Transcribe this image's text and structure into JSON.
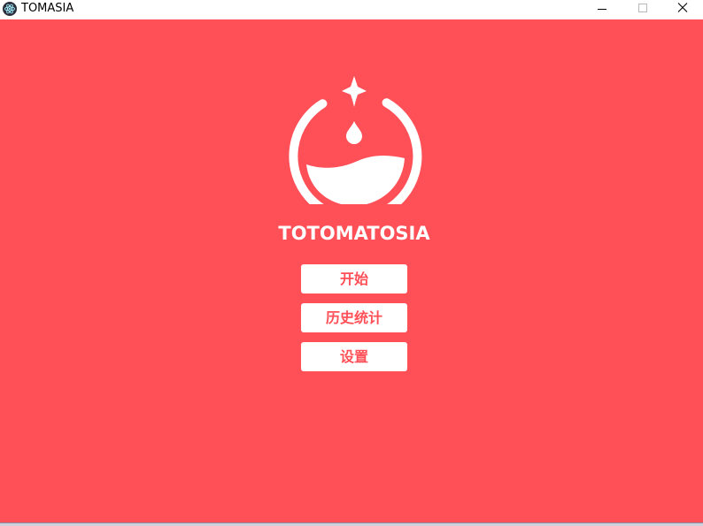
{
  "window": {
    "title": "TOMASIA",
    "app_icon": "electron-atom-icon",
    "controls": {
      "minimize_icon": "minimize-icon",
      "maximize_icon": "maximize-icon",
      "close_icon": "close-icon"
    }
  },
  "main": {
    "logo_icon": "tomato-timer-logo-icon",
    "app_name": "TOTOMATOSIA",
    "menu": {
      "start_label": "开始",
      "history_label": "历史统计",
      "settings_label": "设置"
    }
  },
  "colors": {
    "accent": "#ff4f57",
    "button_bg": "#ffffff",
    "titlebar_bg": "#ffffff"
  }
}
